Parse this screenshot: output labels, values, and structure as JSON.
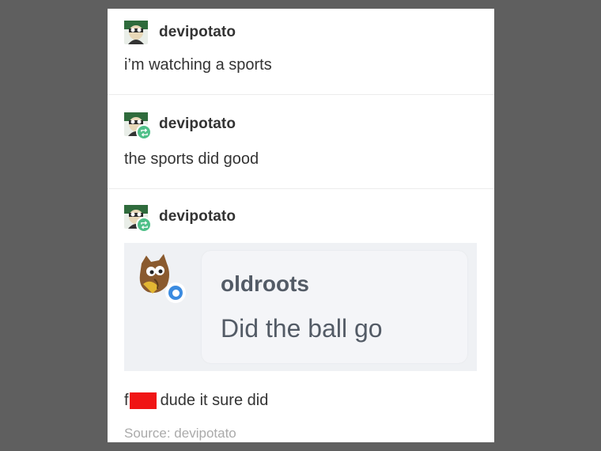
{
  "posts": [
    {
      "username": "devipotato",
      "text": "i’m watching a sports",
      "reblog": false
    },
    {
      "username": "devipotato",
      "text": "the sports did good",
      "reblog": true
    },
    {
      "username": "devipotato",
      "reblog": true
    }
  ],
  "quote": {
    "username": "oldroots",
    "text": "Did the ball go",
    "badge_icon": "chat-bubble-icon"
  },
  "final": {
    "prefix": "f",
    "suffix": "dude it sure did",
    "redaction_color": "#f01414"
  },
  "source": "Source: devipotato",
  "colors": {
    "background": "#5f5f5f",
    "card": "#ffffff",
    "reblog_badge": "#4fbf88",
    "chat_badge": "#3b8be0"
  }
}
